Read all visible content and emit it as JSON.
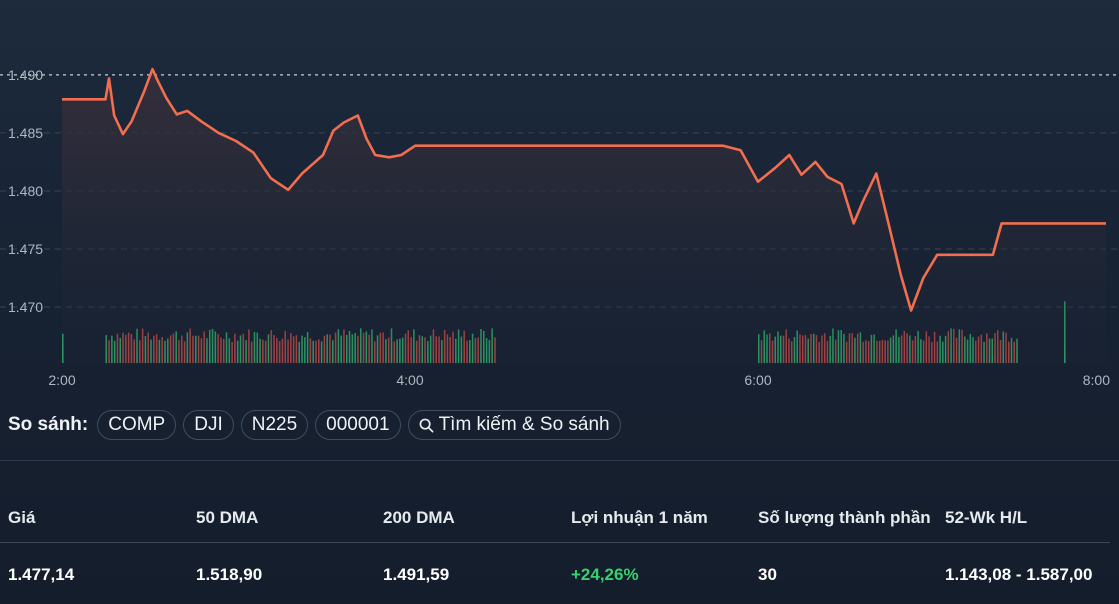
{
  "chart_data": {
    "type": "line",
    "y_ticks": [
      "1.490",
      "1.485",
      "1.480",
      "1.475",
      "1.470"
    ],
    "y_tick_values": [
      1490,
      1485,
      1480,
      1475,
      1470
    ],
    "x_ticks": [
      "2:00",
      "4:00",
      "6:00",
      "8:00"
    ],
    "x_tick_values": [
      2,
      4,
      6,
      8
    ],
    "ylim": [
      1465,
      1494.3
    ],
    "xlim": [
      2,
      8
    ],
    "reference_level": 1490,
    "line_color": "#f26e4f",
    "up_color": "#2fb36e",
    "down_color": "#c44a45",
    "series": [
      {
        "x": [
          2.0,
          2.25,
          2.27,
          2.3,
          2.35,
          2.4,
          2.47,
          2.52,
          2.55,
          2.6,
          2.66,
          2.72,
          2.8,
          2.9,
          3.0,
          3.1,
          3.2,
          3.3,
          3.38,
          3.44,
          3.5,
          3.56,
          3.62,
          3.7,
          3.75,
          3.8,
          3.88,
          3.95,
          4.03,
          4.08,
          4.13,
          4.18,
          4.25,
          4.33,
          4.4,
          4.5,
          4.55,
          5.8,
          5.9,
          6.0,
          6.1,
          6.18,
          6.25,
          6.33,
          6.4,
          6.48,
          6.55,
          6.6,
          6.68,
          6.75,
          6.82,
          6.88,
          6.95,
          7.03,
          7.1,
          7.15,
          7.2,
          7.28,
          7.35,
          7.4,
          7.45,
          7.5,
          7.56,
          7.6,
          7.63,
          7.7,
          7.78,
          7.83,
          7.84,
          8.0
        ],
        "values": [
          1487.9,
          1487.9,
          1489.7,
          1486.5,
          1484.9,
          1486.0,
          1488.5,
          1490.5,
          1489.5,
          1488.0,
          1486.6,
          1486.9,
          1486.0,
          1485.0,
          1484.3,
          1483.3,
          1481.1,
          1480.1,
          1481.5,
          1482.3,
          1483.1,
          1485.2,
          1485.9,
          1486.5,
          1484.5,
          1483.1,
          1482.9,
          1483.1,
          1483.9,
          1483.9,
          1483.9,
          1483.9,
          1483.9,
          1483.9,
          1483.9,
          1483.9,
          1483.9,
          1483.9,
          1483.5,
          1480.8,
          1482.0,
          1483.1,
          1481.4,
          1482.5,
          1481.2,
          1480.6,
          1477.2,
          1479.0,
          1481.5,
          1477.2,
          1472.8,
          1469.7,
          1472.5,
          1474.5,
          1474.5,
          1474.5,
          1474.5,
          1474.5,
          1474.5,
          1477.2,
          1477.2,
          1477.2,
          1477.2,
          1477.2,
          1477.2,
          1477.2,
          1477.2,
          1477.2,
          1477.2,
          1477.2
        ]
      }
    ],
    "volume_segments": [
      {
        "start": 2.25,
        "end": 4.5,
        "bars": 140
      },
      {
        "start": 6.0,
        "end": 7.5,
        "bars": 95
      }
    ],
    "volume_singles": [
      {
        "x": 2.0,
        "value": 0.45,
        "up": true
      },
      {
        "x": 8.0,
        "value": 0.95,
        "up": true
      }
    ]
  },
  "compare": {
    "label": "So sánh:",
    "chips": [
      "COMP",
      "DJI",
      "N225",
      "000001"
    ],
    "search_label": "Tìm kiếm & So sánh",
    "search_icon": "search-icon"
  },
  "stats": {
    "headers": [
      "Giá",
      "50 DMA",
      "200 DMA",
      "Lợi nhuận 1 năm",
      "Số lượng thành phần",
      "52-Wk H/L"
    ],
    "values": [
      "1.477,14",
      "1.518,90",
      "1.491,59",
      "+24,26%",
      "30",
      "1.143,08 - 1.587,00"
    ],
    "positive_color": "#3ad06f"
  }
}
